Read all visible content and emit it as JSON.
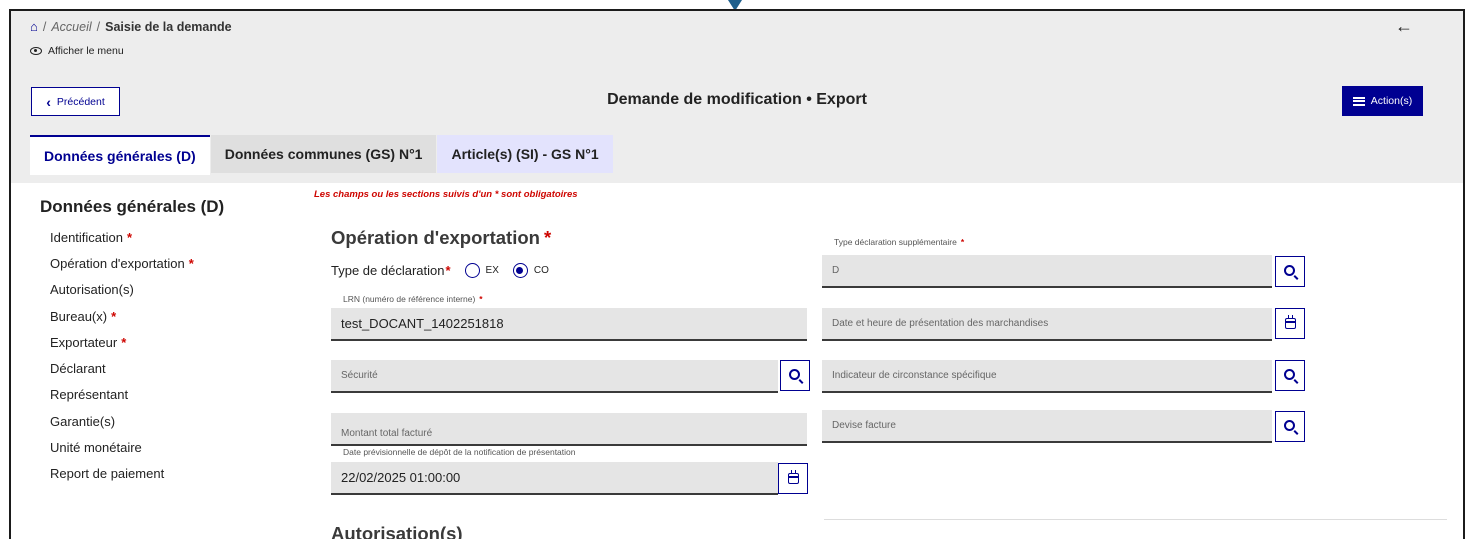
{
  "breadcrumb": {
    "sep": "/",
    "home_link": "Accueil",
    "current": "Saisie de la demande"
  },
  "menu_toggle": {
    "label": "Afficher le menu"
  },
  "header": {
    "back_icon": "←",
    "prev_label": "Précédent",
    "prev_icon": "‹",
    "title": "Demande de modification • Export",
    "action_label": "Action(s)"
  },
  "tabs": [
    "Données générales (D)",
    "Données communes (GS) N°1",
    "Article(s) (SI) - GS N°1"
  ],
  "sidebar": {
    "title": "Données générales (D)",
    "items": [
      {
        "label": "Identification",
        "star": "*"
      },
      {
        "label": "Opération d'exportation",
        "star": "*"
      },
      {
        "label": "Autorisation(s)",
        "star": ""
      },
      {
        "label": "Bureau(x)",
        "star": "*"
      },
      {
        "label": "Exportateur",
        "star": "*"
      },
      {
        "label": "Déclarant",
        "star": ""
      },
      {
        "label": "Représentant",
        "star": ""
      },
      {
        "label": "Garantie(s)",
        "star": ""
      },
      {
        "label": "Unité monétaire",
        "star": ""
      },
      {
        "label": "Report de paiement",
        "star": ""
      }
    ]
  },
  "form": {
    "required_note": "Les champs ou les sections suivis d'un * sont obligatoires",
    "section_title": "Opération d'exportation",
    "section_star": "*",
    "type_label": "Type de déclaration",
    "type_star": "*",
    "type_options": [
      "EX",
      "CO"
    ],
    "type_selected": "CO",
    "type_supp_label": "Type déclaration supplémentaire",
    "type_supp_star": "*",
    "type_supp_value": "D",
    "lrn_label": "LRN (numéro de référence interne)",
    "lrn_star": "*",
    "lrn_value": "test_DOCANT_1402251818",
    "date_presentation_placeholder": "Date et heure de présentation des marchandises",
    "securite_placeholder": "Sécurité",
    "indicateur_placeholder": "Indicateur de circonstance spécifique",
    "montant_placeholder": "Montant total facturé",
    "devise_placeholder": "Devise facture",
    "date_depot_label": "Date prévisionnelle de dépôt de la notification de présentation",
    "date_depot_value": "22/02/2025 01:00:00",
    "next_section_title": "Autorisation(s)"
  },
  "colors": {
    "primary": "#000091",
    "required": "#ce0500",
    "header_bg": "#ededed"
  }
}
